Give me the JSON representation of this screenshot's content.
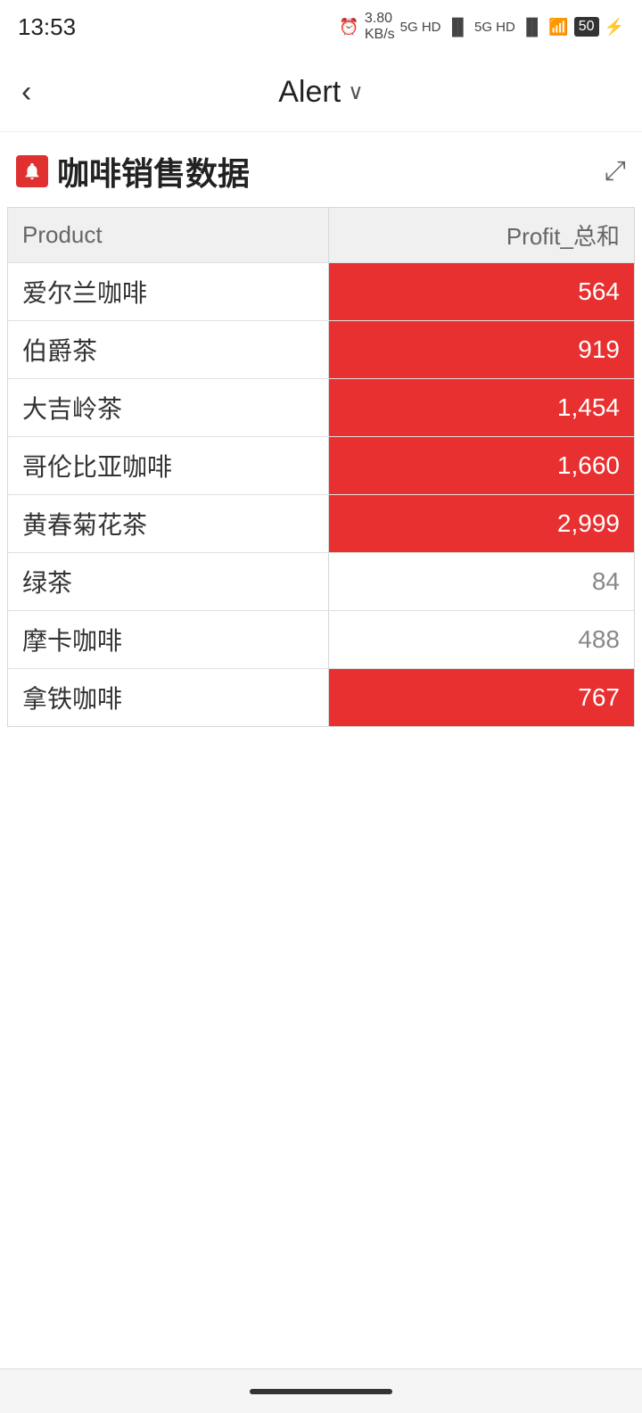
{
  "statusBar": {
    "time": "13:53",
    "batteryLevel": "50",
    "network": "5G HD"
  },
  "navBar": {
    "backLabel": "‹",
    "title": "Alert",
    "chevron": "∨"
  },
  "card": {
    "title": "咖啡销售数据",
    "expandIcon": "⤢"
  },
  "table": {
    "headers": {
      "product": "Product",
      "profit": "Profit_总和"
    },
    "rows": [
      {
        "product": "爱尔兰咖啡",
        "profit": "564",
        "highlight": true
      },
      {
        "product": "伯爵茶",
        "profit": "919",
        "highlight": true
      },
      {
        "product": "大吉岭茶",
        "profit": "1,454",
        "highlight": true
      },
      {
        "product": "哥伦比亚咖啡",
        "profit": "1,660",
        "highlight": true
      },
      {
        "product": "黄春菊花茶",
        "profit": "2,999",
        "highlight": true
      },
      {
        "product": "绿茶",
        "profit": "84",
        "highlight": false
      },
      {
        "product": "摩卡咖啡",
        "profit": "488",
        "highlight": false
      },
      {
        "product": "拿铁咖啡",
        "profit": "767",
        "highlight": true
      }
    ]
  }
}
